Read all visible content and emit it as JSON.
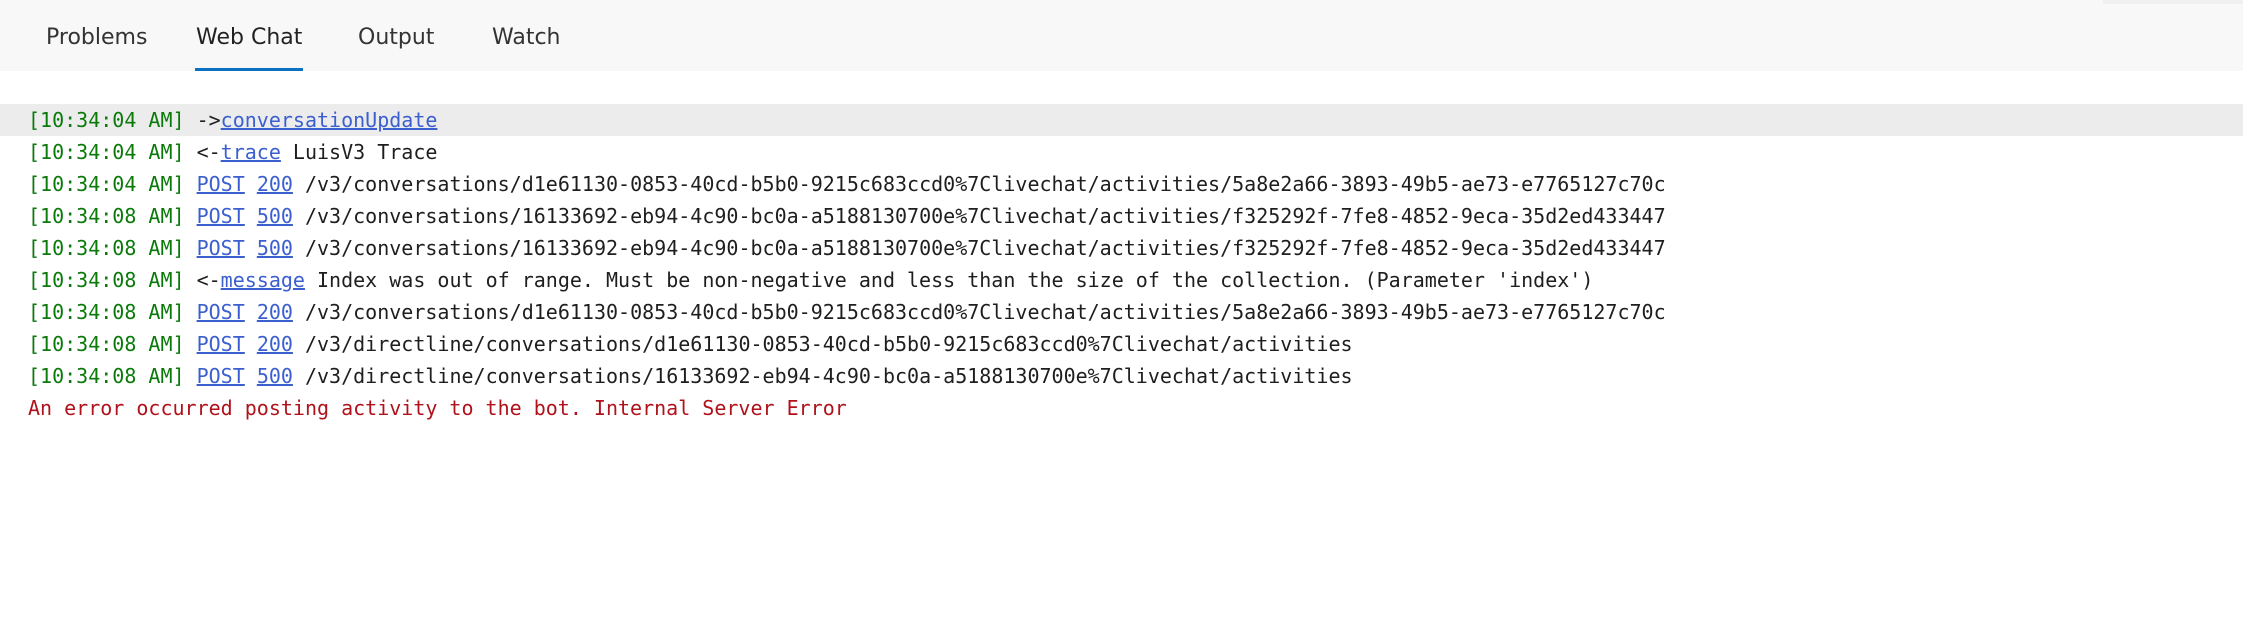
{
  "tabs": [
    {
      "label": "Problems",
      "active": false
    },
    {
      "label": "Web Chat",
      "active": true
    },
    {
      "label": "Output",
      "active": false
    },
    {
      "label": "Watch",
      "active": false
    }
  ],
  "accent_color": "#0e70c0",
  "log": [
    {
      "time": "[10:34:04 AM]",
      "dir": " ->",
      "kind": "activity",
      "link": "conversationUpdate",
      "text": ""
    },
    {
      "time": "[10:34:04 AM]",
      "dir": " <-",
      "kind": "activity",
      "link": "trace",
      "text": " LuisV3 Trace"
    },
    {
      "time": "[10:34:04 AM]",
      "kind": "request",
      "method": "POST",
      "status": "200",
      "text": " /v3/conversations/d1e61130-0853-40cd-b5b0-9215c683ccd0%7Clivechat/activities/5a8e2a66-3893-49b5-ae73-e7765127c70c"
    },
    {
      "time": "[10:34:08 AM]",
      "kind": "request",
      "method": "POST",
      "status": "500",
      "text": " /v3/conversations/16133692-eb94-4c90-bc0a-a5188130700e%7Clivechat/activities/f325292f-7fe8-4852-9eca-35d2ed433447"
    },
    {
      "time": "[10:34:08 AM]",
      "kind": "request",
      "method": "POST",
      "status": "500",
      "text": " /v3/conversations/16133692-eb94-4c90-bc0a-a5188130700e%7Clivechat/activities/f325292f-7fe8-4852-9eca-35d2ed433447"
    },
    {
      "time": "[10:34:08 AM]",
      "dir": " <-",
      "kind": "activity",
      "link": "message",
      "text": " Index was out of range. Must be non-negative and less than the size of the collection. (Parameter 'index')"
    },
    {
      "time": "[10:34:08 AM]",
      "kind": "request",
      "method": "POST",
      "status": "200",
      "text": " /v3/conversations/d1e61130-0853-40cd-b5b0-9215c683ccd0%7Clivechat/activities/5a8e2a66-3893-49b5-ae73-e7765127c70c"
    },
    {
      "time": "[10:34:08 AM]",
      "kind": "request",
      "method": "POST",
      "status": "200",
      "text": " /v3/directline/conversations/d1e61130-0853-40cd-b5b0-9215c683ccd0%7Clivechat/activities"
    },
    {
      "time": "[10:34:08 AM]",
      "kind": "request",
      "method": "POST",
      "status": "500",
      "text": " /v3/directline/conversations/16133692-eb94-4c90-bc0a-a5188130700e%7Clivechat/activities"
    }
  ],
  "error_message": "An error occurred posting activity to the bot. Internal Server Error"
}
